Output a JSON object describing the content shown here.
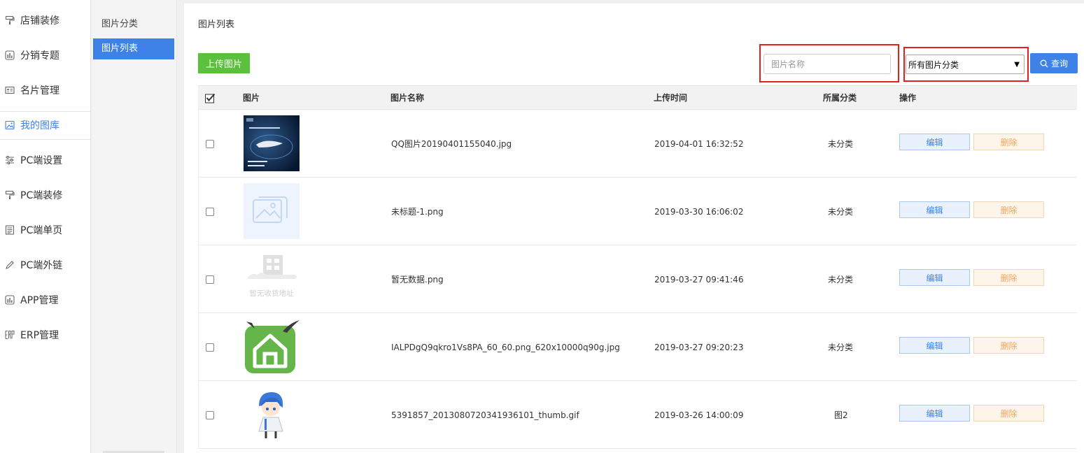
{
  "sidebar": {
    "items": [
      {
        "label": "店铺装修",
        "icon": "paint-roller-icon"
      },
      {
        "label": "分销专题",
        "icon": "chart-box-icon"
      },
      {
        "label": "名片管理",
        "icon": "id-card-icon"
      },
      {
        "label": "我的图库",
        "icon": "image-icon",
        "active": true
      },
      {
        "label": "PC端设置",
        "icon": "sliders-icon"
      },
      {
        "label": "PC端装修",
        "icon": "paint-roller-icon"
      },
      {
        "label": "PC端单页",
        "icon": "document-icon"
      },
      {
        "label": "PC端外链",
        "icon": "pencil-icon"
      },
      {
        "label": "APP管理",
        "icon": "chart-box-icon"
      },
      {
        "label": "ERP管理",
        "icon": "erp-icon"
      }
    ]
  },
  "subnav": {
    "items": [
      {
        "label": "图片分类"
      },
      {
        "label": "图片列表",
        "active": true
      }
    ]
  },
  "main": {
    "title": "图片列表",
    "upload_label": "上传图片",
    "search_placeholder": "图片名称",
    "category_select": "所有图片分类",
    "query_label": "查询"
  },
  "table": {
    "headers": {
      "image": "图片",
      "name": "图片名称",
      "time": "上传时间",
      "category": "所属分类",
      "action": "操作"
    },
    "edit_label": "编辑",
    "delete_label": "删除",
    "rows": [
      {
        "name": "QQ图片20190401155040.jpg",
        "time": "2019-04-01 16:32:52",
        "category": "未分类",
        "thumb": "poster"
      },
      {
        "name": "未标题-1.png",
        "time": "2019-03-30 16:06:02",
        "category": "未分类",
        "thumb": "placeholder"
      },
      {
        "name": "暂无数据.png",
        "time": "2019-03-27 09:41:46",
        "category": "未分类",
        "thumb": "no-data",
        "thumb_caption": "暂无收货地址"
      },
      {
        "name": "IALPDgQ9qkro1Vs8PA_60_60.png_620x10000q90g.jpg",
        "time": "2019-03-27 09:20:23",
        "category": "未分类",
        "thumb": "house-logo"
      },
      {
        "name": "5391857_201308072034193610​1_thumb.gif",
        "time": "2019-03-26 14:00:09",
        "category": "图2",
        "thumb": "anime-character"
      }
    ]
  },
  "colors": {
    "primary": "#3e82e8",
    "success": "#5bc03c",
    "highlight": "#e8201d",
    "warning": "#f0a75f"
  }
}
